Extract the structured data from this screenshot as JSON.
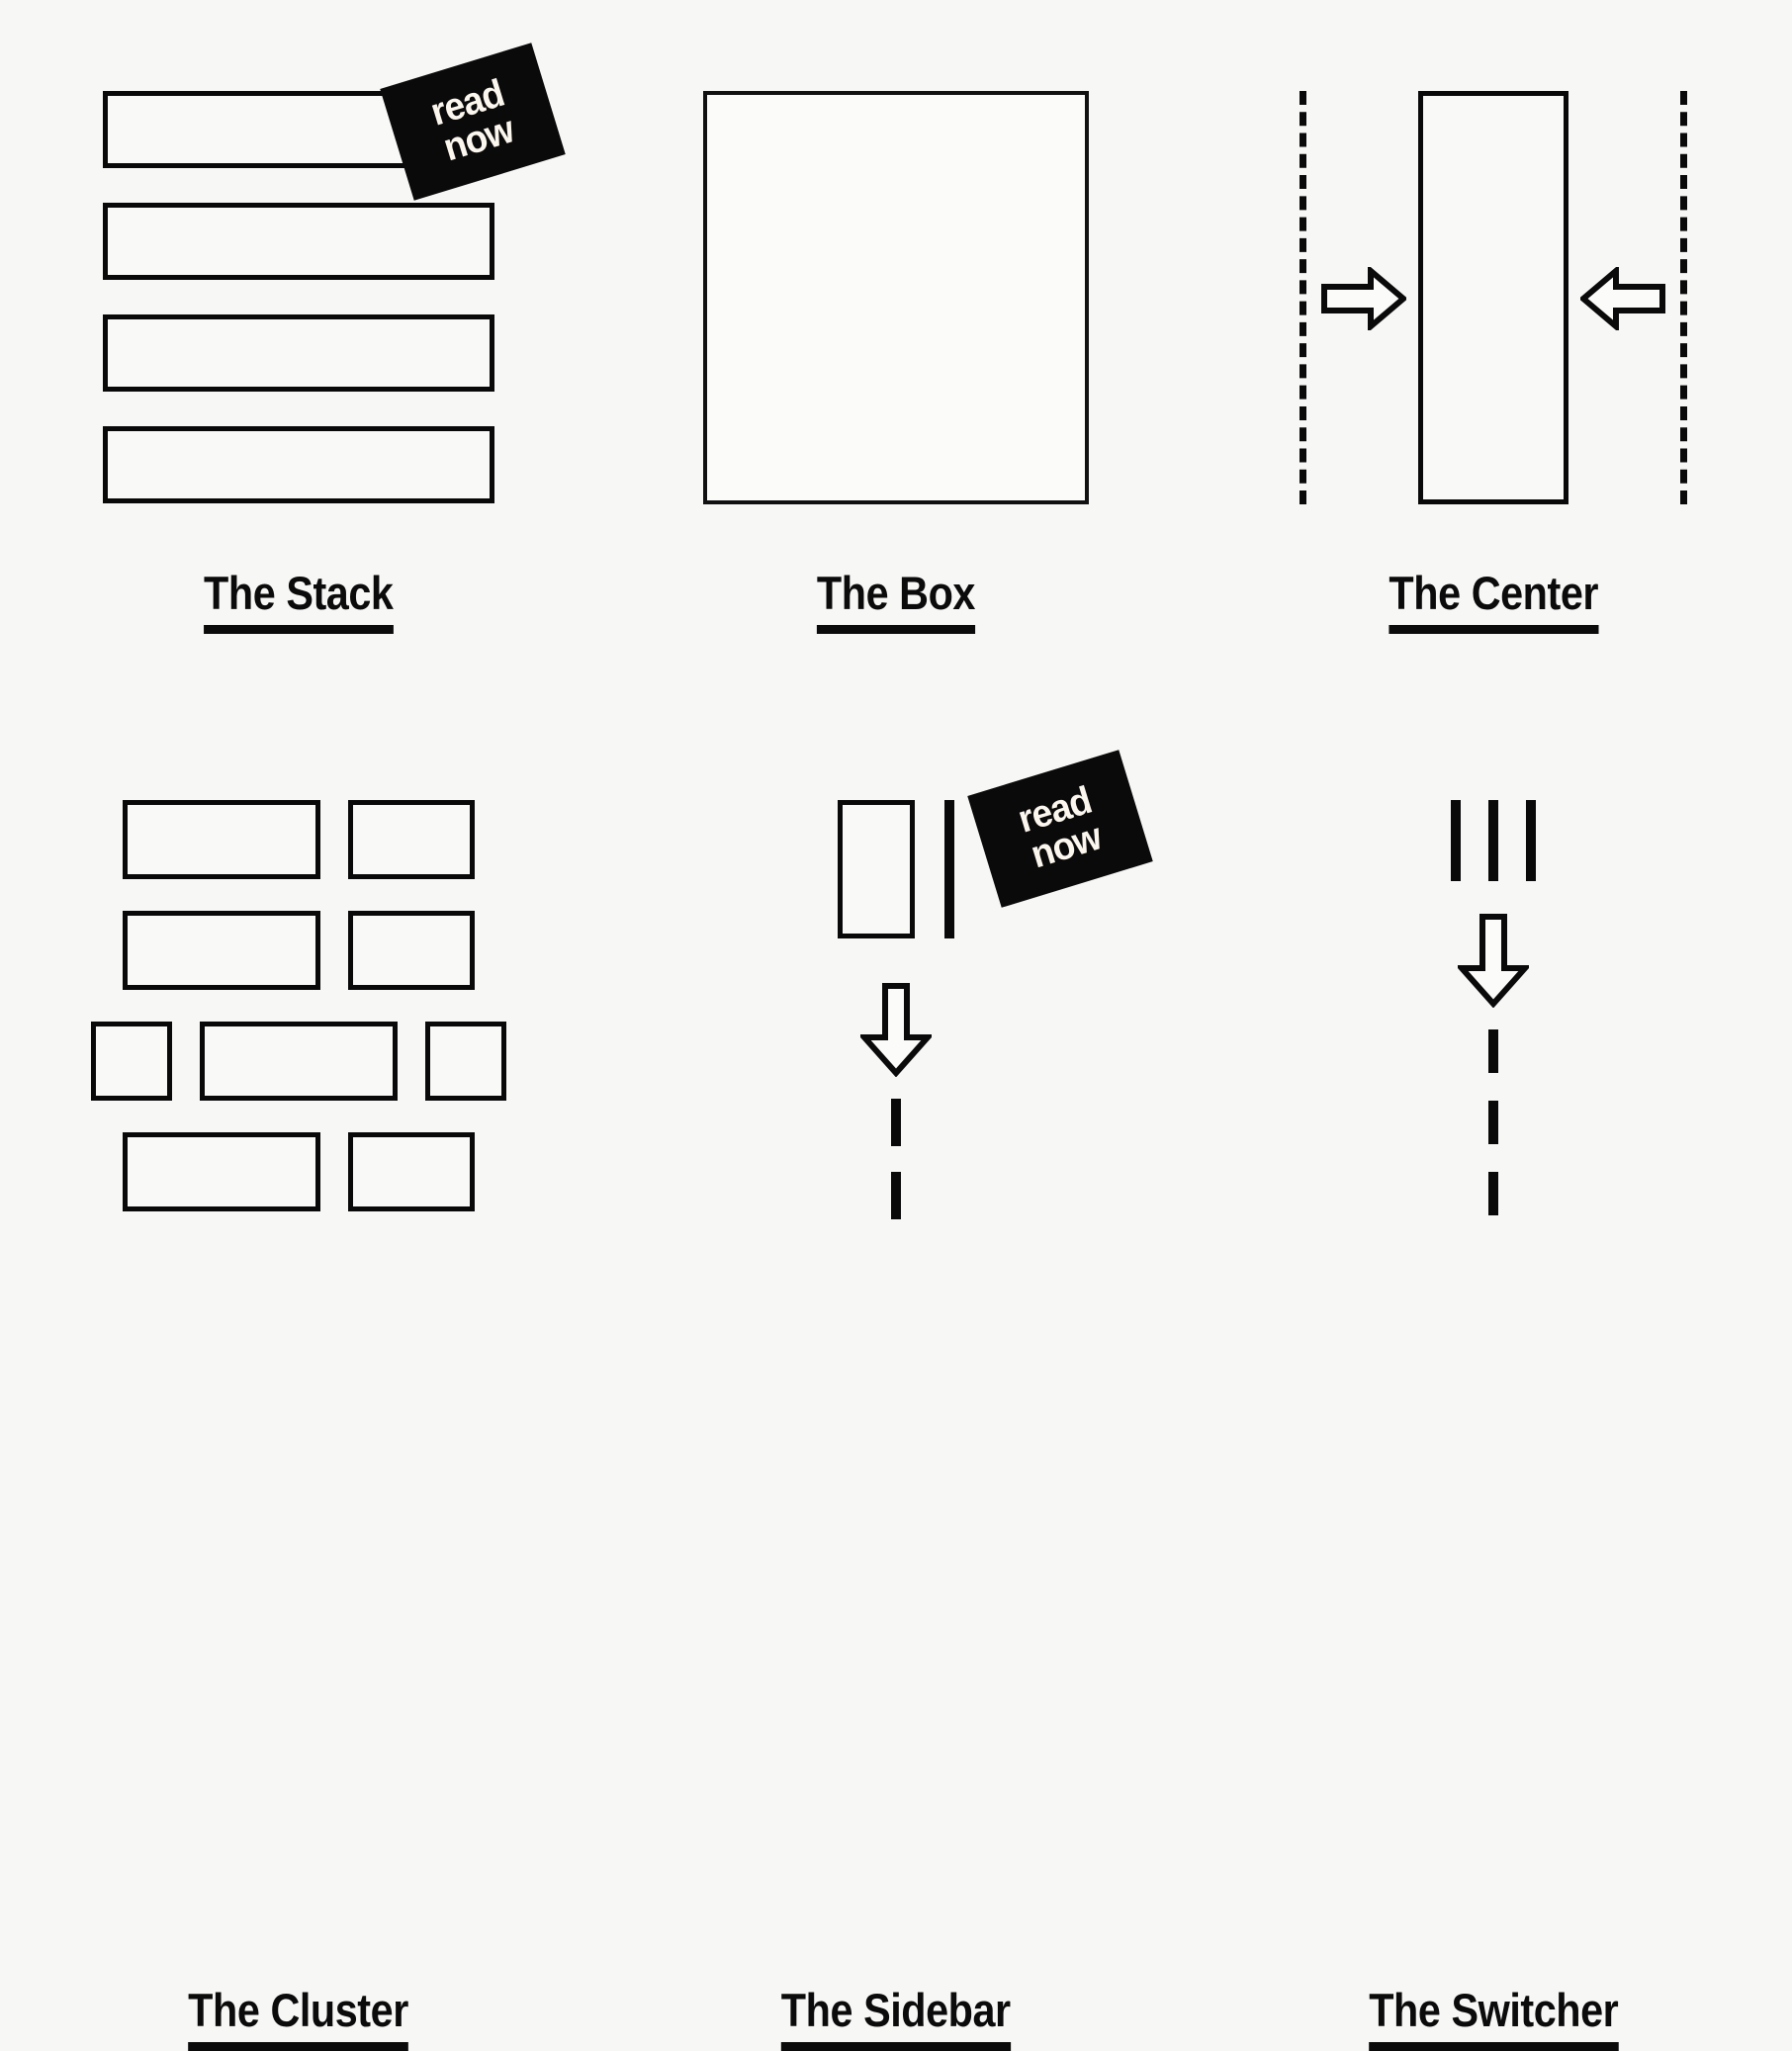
{
  "background_color": "#f7f7f6",
  "ink_color": "#090909",
  "sticker": {
    "line1": "read",
    "line2": "now",
    "background_color": "#0b0a0a",
    "text_color": "#fbf6ee",
    "rotation_deg": -17
  },
  "panels": [
    {
      "id": "stack",
      "caption": "The Stack",
      "icon": "stack-icon",
      "description": "four full-width stacked boxes",
      "boxes": 4,
      "has_sticker": true
    },
    {
      "id": "box",
      "caption": "The Box",
      "icon": "box-icon",
      "description": "single large square box",
      "boxes": 1,
      "has_sticker": false
    },
    {
      "id": "center",
      "caption": "The Center",
      "icon": "center-icon",
      "description": "tall centered column between two dashed rails with arrows pointing inward",
      "boxes": 1,
      "has_sticker": false,
      "arrows": [
        "arrow-right-icon",
        "arrow-left-icon"
      ]
    },
    {
      "id": "cluster",
      "caption": "The Cluster",
      "icon": "cluster-icon",
      "description": "four rows of mixed-width boxes",
      "rows": [
        [
          "lg",
          "md"
        ],
        [
          "lg",
          "md"
        ],
        [
          "sm",
          "lg",
          "sm"
        ],
        [
          "lg",
          "md"
        ]
      ],
      "has_sticker": false
    },
    {
      "id": "sidebar",
      "caption": "The Sidebar",
      "icon": "sidebar-icon",
      "description": "narrow sidebar plus wide main area collapsing into stacked bars",
      "top_boxes": 2,
      "bottom_bars": 2,
      "arrow": "arrow-down-icon",
      "has_sticker": true
    },
    {
      "id": "switcher",
      "caption": "The Switcher",
      "icon": "switcher-icon",
      "description": "three equal columns switching to three full-width bars",
      "top_boxes": 3,
      "bottom_bars": 3,
      "arrow": "arrow-down-icon",
      "has_sticker": false
    }
  ]
}
